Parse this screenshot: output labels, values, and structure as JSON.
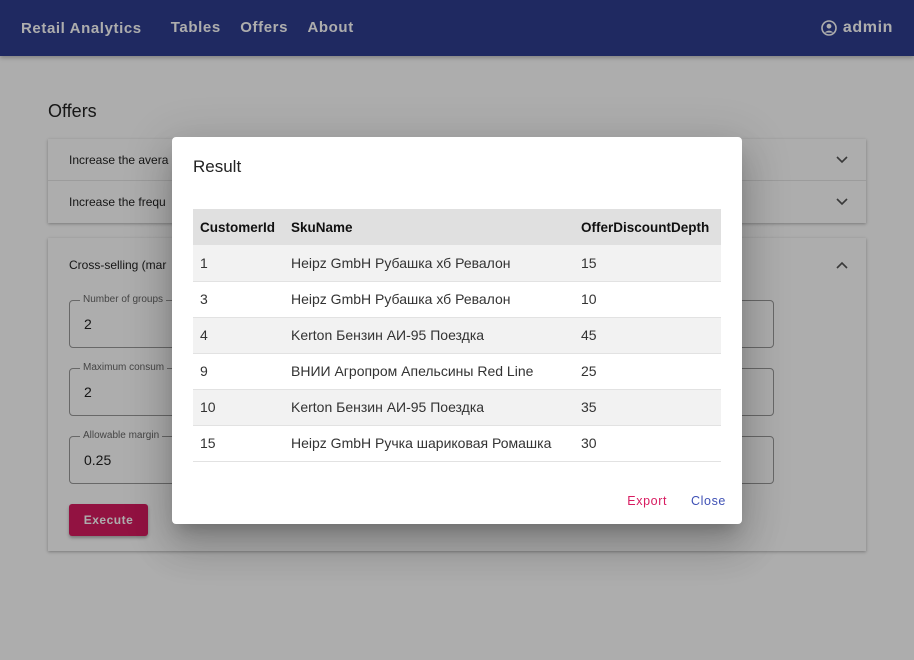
{
  "appbar": {
    "brand": "Retail Analytics",
    "nav": [
      "Tables",
      "Offers",
      "About"
    ],
    "user": "admin",
    "color": "#2f3d8f"
  },
  "page": {
    "title": "Offers",
    "accordions": [
      "Increase the avera",
      "Increase the frequ",
      "Cross-selling (mar"
    ],
    "fields": [
      {
        "label": "Number of groups",
        "value": "2"
      },
      {
        "label": "Maximum consum",
        "value": "2"
      },
      {
        "label": "Allowable margin",
        "value": "0.25"
      }
    ],
    "execute_label": "Execute"
  },
  "dialog": {
    "title": "Result",
    "columns": [
      "CustomerId",
      "SkuName",
      "OfferDiscountDepth"
    ],
    "rows": [
      [
        "1",
        "Heipz GmbH Рубашка хб Ревалон",
        "15"
      ],
      [
        "3",
        "Heipz GmbH Рубашка хб Ревалон",
        "10"
      ],
      [
        "4",
        "Kerton Бензин АИ-95 Поездка",
        "45"
      ],
      [
        "9",
        "ВНИИ Агропром Апельсины Red Line",
        "25"
      ],
      [
        "10",
        "Kerton Бензин АИ-95 Поездка",
        "35"
      ],
      [
        "15",
        "Heipz GmbH Ручка шариковая Ромашка",
        "30"
      ]
    ],
    "export_label": "Export",
    "close_label": "Close"
  }
}
